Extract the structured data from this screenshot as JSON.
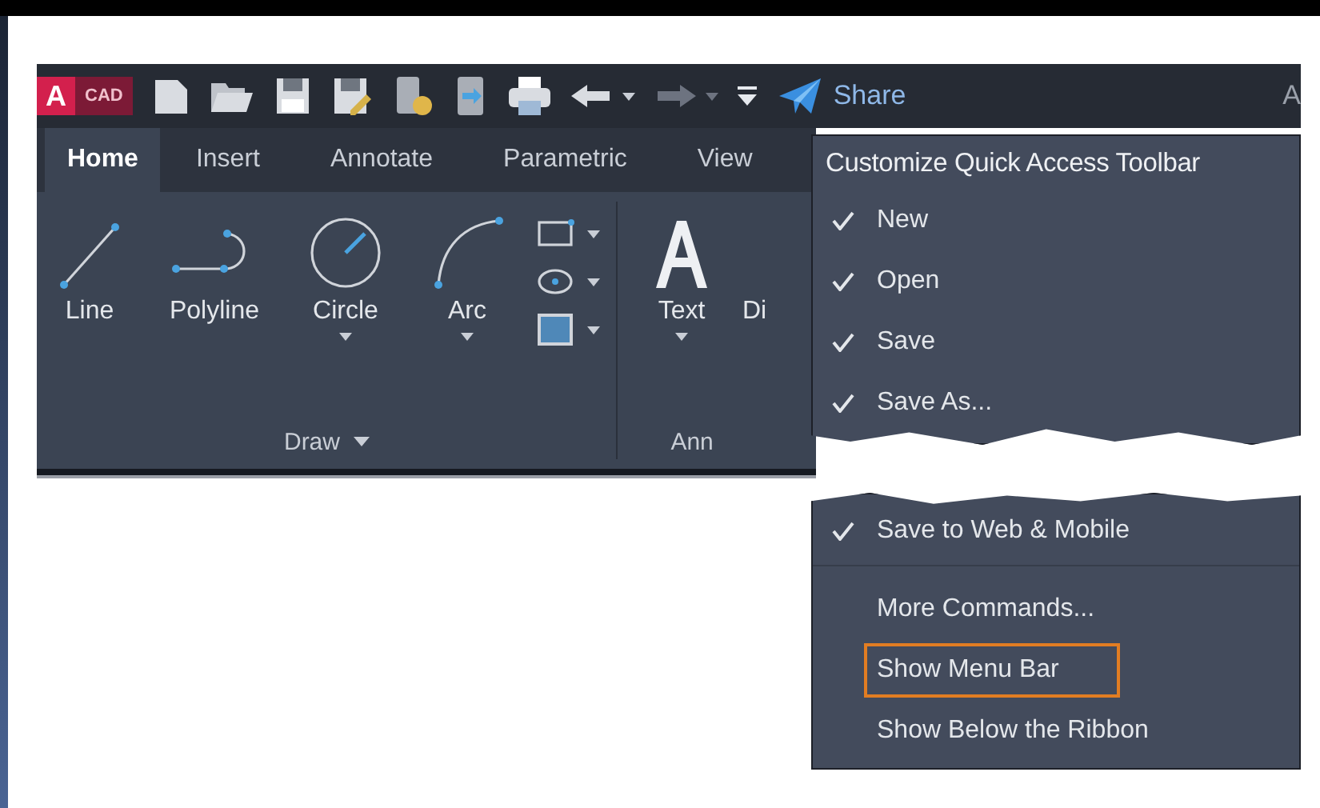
{
  "quick_access_toolbar": {
    "logo_letter": "A",
    "logo_text": "CAD",
    "undo": {
      "disabled": false
    },
    "redo": {
      "disabled": true
    },
    "share": "Share",
    "account": "A"
  },
  "tabs": [
    {
      "label": "Home",
      "selected": true
    },
    {
      "label": "Insert",
      "selected": false
    },
    {
      "label": "Annotate",
      "selected": false
    },
    {
      "label": "Parametric",
      "selected": false
    },
    {
      "label": "View",
      "selected": false
    }
  ],
  "panels": [
    {
      "kind": "draw",
      "title": "Draw",
      "has_menu": true,
      "tools": [
        {
          "kind": "line",
          "label": "Line",
          "has_dropdown": false
        },
        {
          "kind": "polyline",
          "label": "Polyline",
          "has_dropdown": false
        },
        {
          "kind": "circle",
          "label": "Circle",
          "has_dropdown": true
        },
        {
          "kind": "arc",
          "label": "Arc",
          "has_dropdown": true
        }
      ]
    },
    {
      "kind": "annotation",
      "title": "Ann",
      "has_menu": false,
      "tools": [
        {
          "kind": "text",
          "label": "Text",
          "has_dropdown": true
        },
        {
          "kind": "partial",
          "label": "Di",
          "has_dropdown": false
        }
      ]
    }
  ],
  "menu": {
    "title": "Customize Quick Access Toolbar",
    "sections": [
      {
        "items": [
          {
            "kind": "check",
            "label": "New",
            "checked": true,
            "highlighted": false
          },
          {
            "kind": "check",
            "label": "Open",
            "checked": true,
            "highlighted": false
          },
          {
            "kind": "check",
            "label": "Save",
            "checked": true,
            "highlighted": false
          },
          {
            "kind": "check",
            "label": "Save As...",
            "checked": true,
            "highlighted": false
          }
        ]
      },
      {
        "items": [
          {
            "kind": "check",
            "label": "Save to Web & Mobile",
            "checked": true,
            "highlighted": false
          },
          {
            "kind": "separator"
          },
          {
            "kind": "command",
            "label": "More Commands...",
            "highlighted": false
          },
          {
            "kind": "command",
            "label": "Show Menu Bar",
            "highlighted": true
          },
          {
            "kind": "command",
            "label": "Show Below the Ribbon",
            "highlighted": false
          }
        ]
      }
    ]
  }
}
